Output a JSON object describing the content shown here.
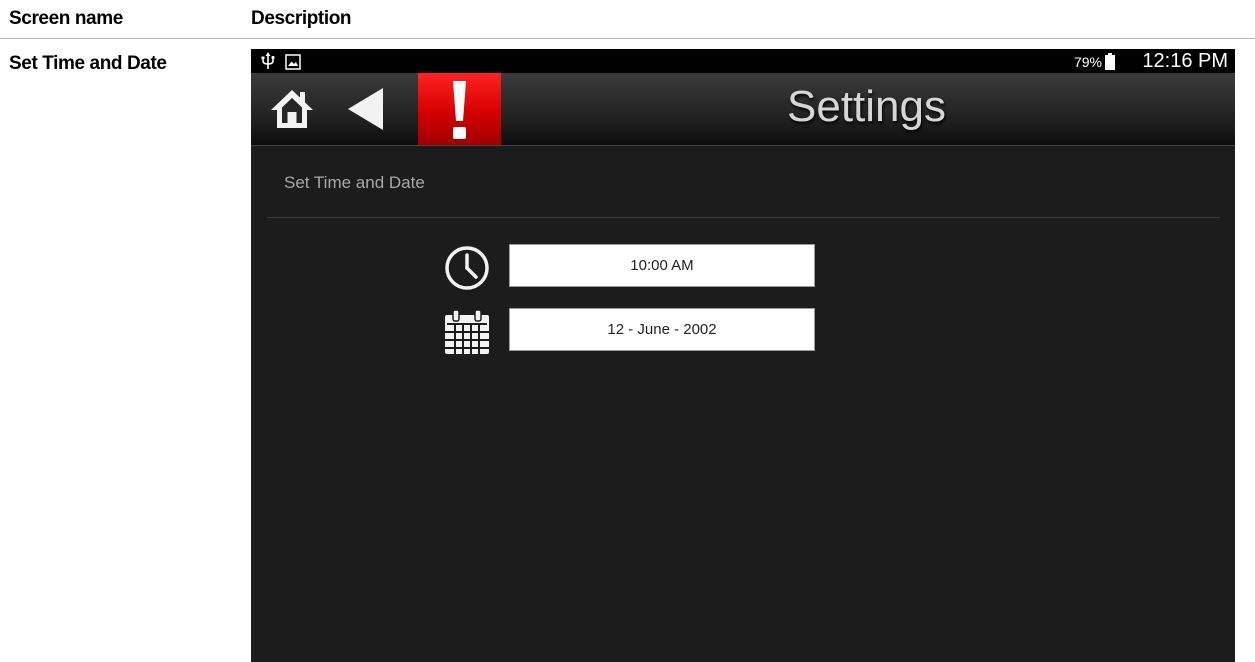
{
  "doc": {
    "col_screen_name": "Screen name",
    "col_description": "Description",
    "screen_name": "Set Time and Date"
  },
  "status_bar": {
    "battery": "79%",
    "time": "12:16 PM",
    "icons": [
      "usb-icon",
      "gallery-icon",
      "battery-icon"
    ]
  },
  "action_bar": {
    "title": "Settings",
    "buttons": [
      "home-icon",
      "back-icon",
      "alert-icon"
    ],
    "alert_color": "#e00000"
  },
  "section": {
    "title": "Set Time and Date"
  },
  "fields": {
    "time_value": "10:00 AM",
    "date_value": "12 - June - 2002",
    "time_icon": "clock-icon",
    "date_icon": "calendar-icon"
  }
}
